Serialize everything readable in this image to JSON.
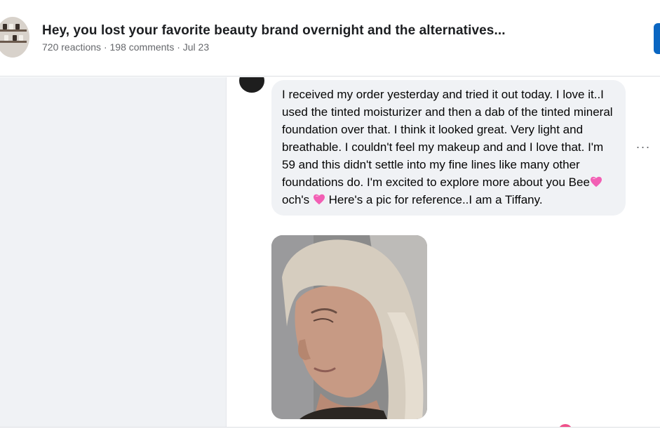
{
  "header": {
    "title": "Hey, you lost your favorite beauty brand overnight and the alternatives...",
    "meta": "720 reactions · 198 comments · Jul 23",
    "thumbnail_icon": "post-thumbnail"
  },
  "comment": {
    "text_part1": "I received my order yesterday and tried it out today. I love it..I used the tinted moisturizer and then a dab of the tinted mineral foundation over that. I think it looked great. Very light and breathable. I couldn't feel my makeup and and I love that. I'm 59 and this didn't settle into my fine lines like many other foundations do. I'm excited to explore more about you Bee",
    "text_part2": "och's ",
    "text_part3": " Here's a pic for reference..I am a Tiffany.",
    "heart_icon": "pink-heart-icon",
    "more_icon": "more-options-icon",
    "more_label": "···",
    "photo_icon": "comment-photo"
  },
  "colors": {
    "accent": "#0a66c2",
    "bubble": "#f0f2f5",
    "heart": "#f25fb4",
    "muted_text": "#65676b"
  }
}
